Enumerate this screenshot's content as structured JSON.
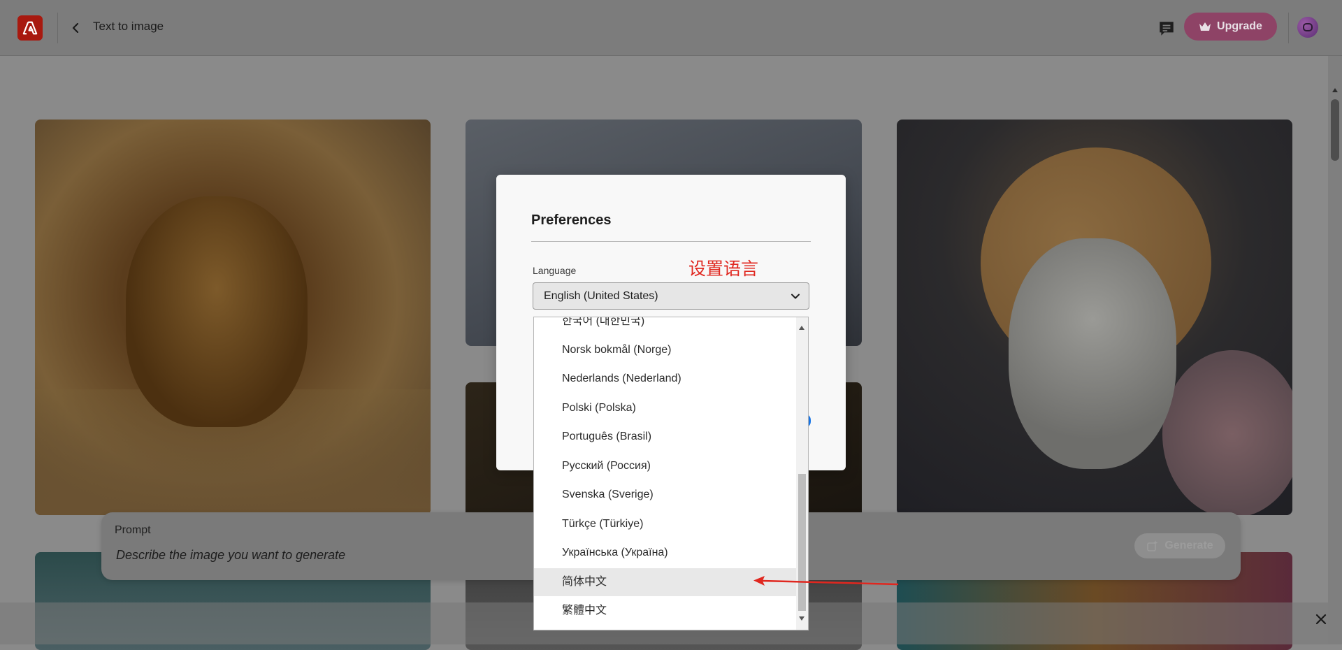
{
  "header": {
    "logo_icon": "adobe-logo-icon",
    "back_icon": "chevron-left-icon",
    "title": "Text to image",
    "feedback_icon": "comment-icon",
    "upgrade_label": "Upgrade",
    "upgrade_icon": "crown-icon",
    "avatar_icon": "user-avatar"
  },
  "gallery": {
    "tiles": [
      "lion",
      "room",
      "dark-frame",
      "bunny-astronaut",
      "bubbles",
      "bw-portrait",
      "paint-splash"
    ]
  },
  "prompt": {
    "label": "Prompt",
    "placeholder": "Describe the image you want to generate",
    "generate_label": "Generate",
    "generate_icon": "generate-icon"
  },
  "modal": {
    "title": "Preferences",
    "language_label": "Language",
    "annotation": "设置语言",
    "selected_language": "English (United States)"
  },
  "dropdown": {
    "items": [
      "한국어 (대한민국)",
      "Norsk bokmål (Norge)",
      "Nederlands (Nederland)",
      "Polski (Polska)",
      "Português (Brasil)",
      "Русский (Россия)",
      "Svenska (Sverige)",
      "Türkçe (Türkiye)",
      "Українська (Україна)",
      "简体中文",
      "繁體中文"
    ],
    "highlighted_index": 9
  },
  "colors": {
    "accent_red": "#e0271f",
    "adobe_red": "#a8190f",
    "upgrade_bg": "#8e4366",
    "primary_blue": "#1473e6"
  }
}
